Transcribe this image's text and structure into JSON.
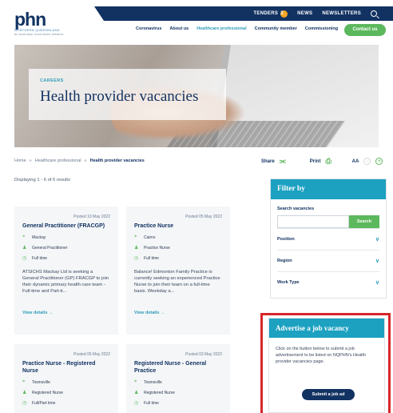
{
  "brand": {
    "logo": "phn",
    "line1": "NORTHERN QUEENSLAND",
    "line2": "An Australian Government Initiative"
  },
  "topbar": {
    "tenders_label": "TENDERS",
    "tenders_count": "3",
    "news_label": "NEWS",
    "newsletters_label": "NEWSLETTERS"
  },
  "nav": {
    "items": [
      "Coronavirus",
      "About us",
      "Healthcare professional",
      "Community member",
      "Commissioning"
    ],
    "contact_label": "Contact us"
  },
  "hero": {
    "eyebrow": "CAREERS",
    "title": "Health provider vacancies"
  },
  "breadcrumb": {
    "home": "Home",
    "sep": "»",
    "section": "Healthcare professional",
    "current": "Health provider vacancies"
  },
  "tools": {
    "share_label": "Share",
    "print_label": "Print",
    "text_size_label": "AA"
  },
  "results": {
    "text": "Displaying 1 - 6 of 6 results"
  },
  "jobs": [
    {
      "posted": "Posted 10 May 2022",
      "title": "General Practitioner (FRACGP)",
      "location": "Mackay",
      "role": "General Practitioner",
      "type": "Full time",
      "description": "ATSICHS Mackay Ltd is seeking a General Practitioner (GP) FRACGP to join their dynamic primary health care team - Full-time and Part-ti...",
      "link": "View details →"
    },
    {
      "posted": "Posted 05 May 2022",
      "title": "Practice Nurse",
      "location": "Cairns",
      "role": "Practice Nurse",
      "type": "Full time",
      "description": "Balance! Edmonton Family Practice is currently seeking an experienced Practice Nurse to join their team on a full-time basis. Weekday a...",
      "link": "View details →"
    },
    {
      "posted": "Posted 05 May 2022",
      "title": "Practice Nurse - Registered Nurse",
      "location": "Townsville",
      "role": "Registered Nurse",
      "type": "Full/Part time"
    },
    {
      "posted": "Posted 03 May 2022",
      "title": "Registered Nurse - General Practice",
      "location": "Townsville",
      "role": "Registered Nurse",
      "type": "Full time"
    }
  ],
  "filter": {
    "heading": "Filter by",
    "search_label": "Search vacancies",
    "search_value": "",
    "search_button": "Search",
    "fields": [
      "Position",
      "Region",
      "Work Type"
    ]
  },
  "advertise": {
    "heading": "Advertise a job vacancy",
    "text": "Click on the button below to submit a job advertisement to be listed on NQPHN's Health provider vacancies page.",
    "button": "Submit a job ad"
  },
  "colors": {
    "navy": "#123262",
    "teal": "#1ca1c1",
    "green": "#5cb85c",
    "highlight": "#d7262b"
  }
}
